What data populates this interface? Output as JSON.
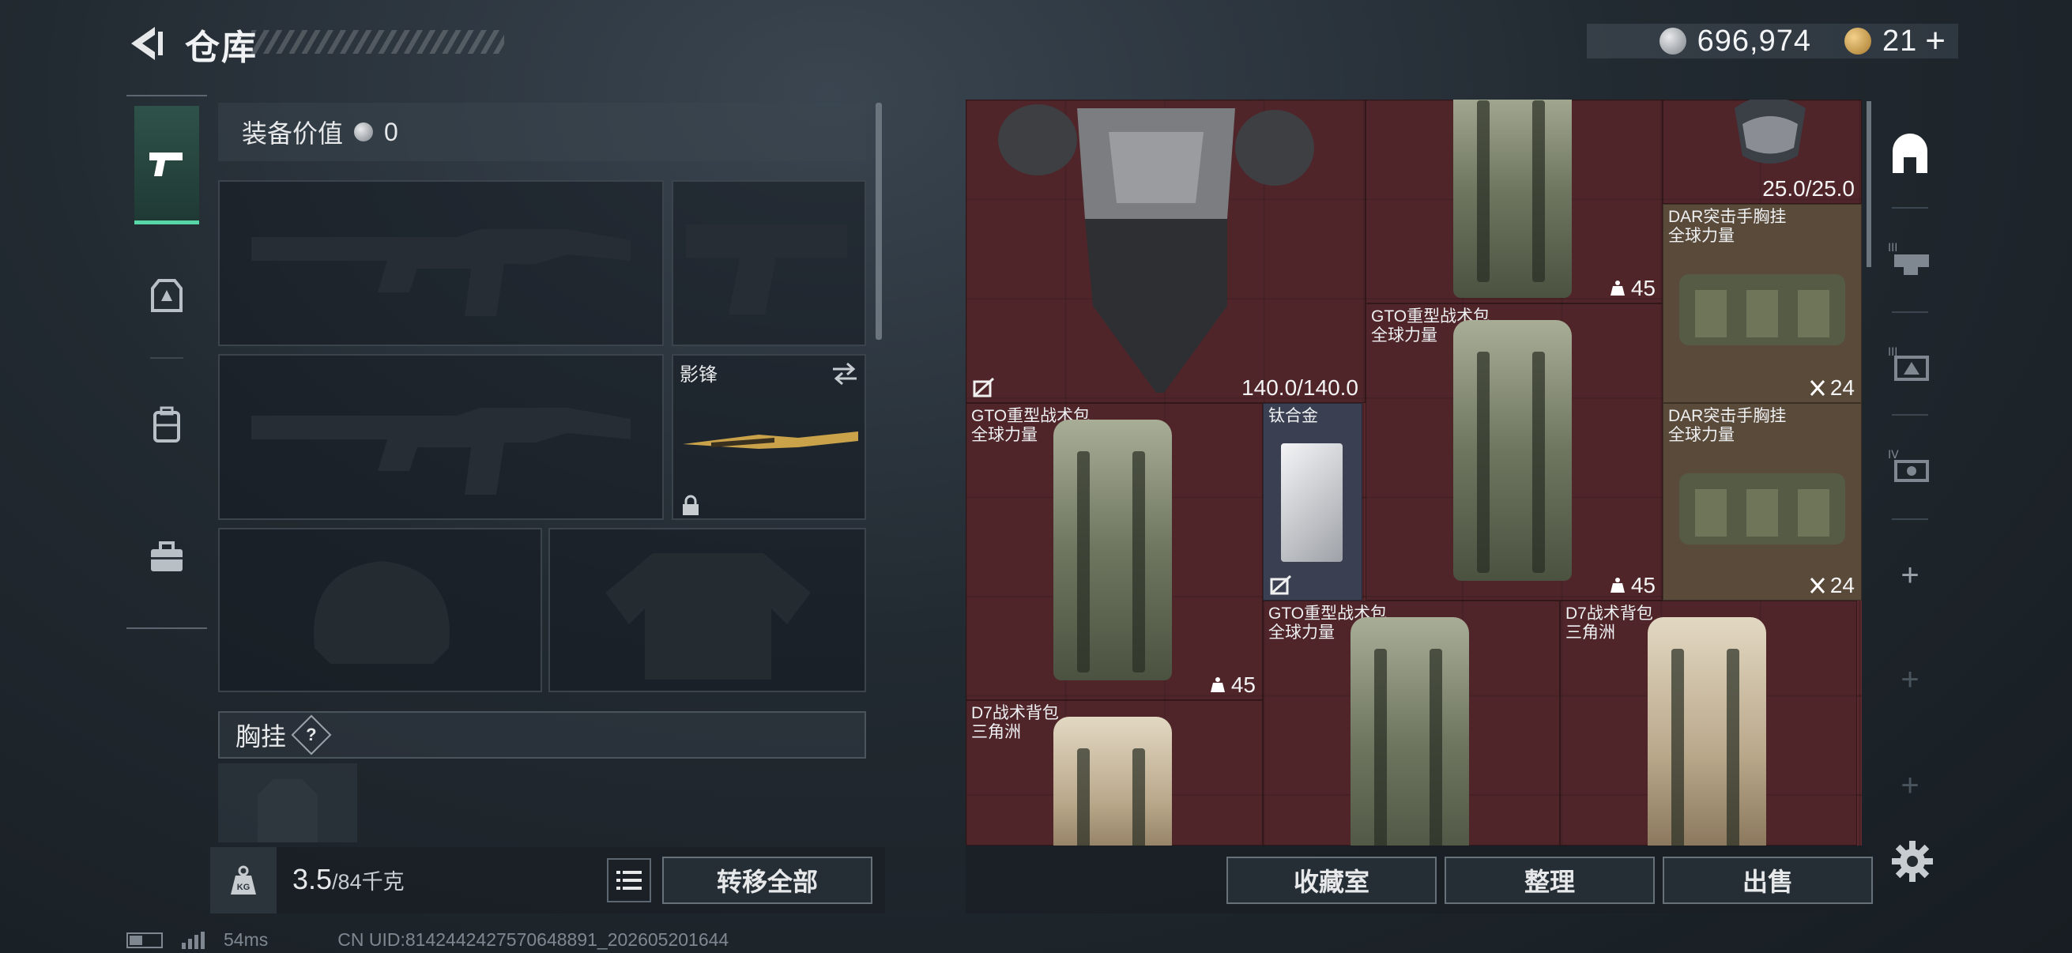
{
  "header": {
    "title": "仓库",
    "currency_silver": "696,974",
    "currency_gold": "21",
    "add_label": "+"
  },
  "equipment": {
    "value_label": "装备价值",
    "value": "0",
    "secondary_weapon_name": "影锋",
    "chest_label": "胸挂",
    "help_label": "?"
  },
  "footer": {
    "weight_current": "3.5",
    "weight_capacity": "/84千克",
    "transfer_all": "转移全部",
    "latency": "54ms",
    "uid": "CN UID:8142442427570648891_202605201644"
  },
  "stash": {
    "items": [
      {
        "name": "",
        "stat": "140.0/140.0"
      },
      {
        "name": "",
        "stat": "45"
      },
      {
        "name": "",
        "stat": "25.0/25.0"
      },
      {
        "name": "DAR突击手胸挂\n全球力量",
        "stat": "24"
      },
      {
        "name": "GTO重型战术包\n全球力量",
        "stat": "45"
      },
      {
        "name": "GTO重型战术包\n全球力量",
        "stat": "45"
      },
      {
        "name": "钛合金",
        "stat": ""
      },
      {
        "name": "DAR突击手胸挂\n全球力量",
        "stat": "24"
      },
      {
        "name": "GTO重型战术包\n全球力量",
        "stat": ""
      },
      {
        "name": "D7战术背包\n三角洲",
        "stat": ""
      },
      {
        "name": "D7战术背包\n三角洲",
        "stat": ""
      }
    ]
  },
  "bottom_bar": {
    "collection_room": "收藏室",
    "organize": "整理",
    "sell": "出售"
  },
  "rail": {
    "plus": "+"
  },
  "colors": {
    "accent_green": "#59d6a8",
    "stash_bg": "#5c2a2e"
  }
}
